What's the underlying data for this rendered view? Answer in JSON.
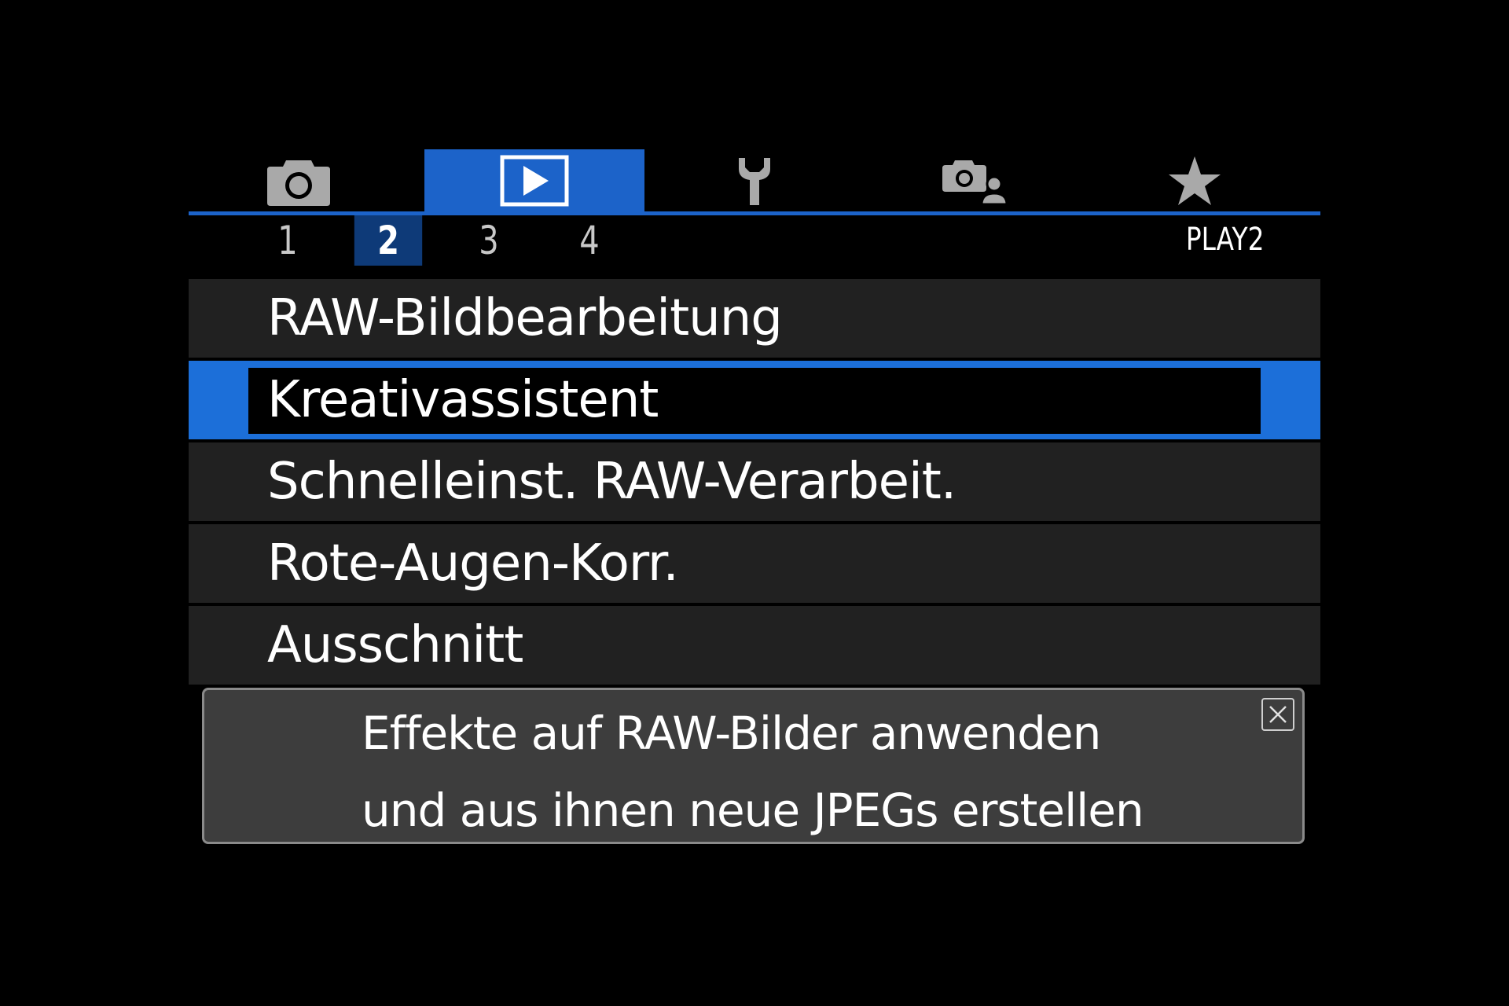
{
  "tabs": [
    {
      "icon": "camera-icon",
      "active": false
    },
    {
      "icon": "play-icon",
      "active": true
    },
    {
      "icon": "wrench-icon",
      "active": false
    },
    {
      "icon": "custom-camera-person-icon",
      "active": false
    },
    {
      "icon": "star-icon",
      "active": false
    }
  ],
  "subtabs": [
    "1",
    "2",
    "3",
    "4"
  ],
  "active_subtab": "2",
  "page_label": "PLAY2",
  "menu": {
    "items": [
      {
        "label": "RAW-Bildbearbeitung"
      },
      {
        "label": "Kreativassistent"
      },
      {
        "label": "Schnelleinst. RAW-Verarbeit."
      },
      {
        "label": "Rote-Augen-Korr."
      },
      {
        "label": "Ausschnitt"
      }
    ],
    "selected_index": 1
  },
  "help": {
    "line1": "Effekte auf RAW-Bilder anwenden",
    "line2": "und aus ihnen neue JPEGs erstellen"
  },
  "colors": {
    "accent": "#1c63c9",
    "selected": "#1c6fd9",
    "active_subtab": "#0e3a78",
    "row_bg": "#212121",
    "help_bg": "#3d3d3d"
  }
}
